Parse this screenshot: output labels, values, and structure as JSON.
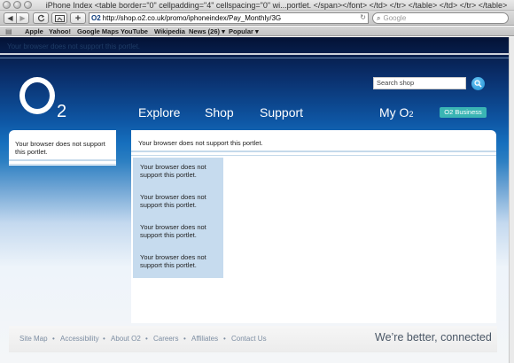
{
  "window": {
    "title": "iPhone Index <table border=\"0\" cellpadding=\"4\" cellspacing=\"0\" wi...portlet. </span></font> </td> </tr> </table> </td> </tr> </table>"
  },
  "toolbar": {
    "back_icon": "◀",
    "forward_icon": "▶",
    "reload_icon": "C",
    "add_icon": "+",
    "url_prefix": "O2",
    "url": "http://shop.o2.co.uk/promo/iphoneindex/Pay_Monthly/3G",
    "search_placeholder": "Google"
  },
  "bookmarks": [
    {
      "label": "Apple"
    },
    {
      "label": "Yahoo!"
    },
    {
      "label": "Google Maps"
    },
    {
      "label": "YouTube"
    },
    {
      "label": "Wikipedia"
    },
    {
      "label": "News (26) ▾"
    },
    {
      "label": "Popular ▾"
    }
  ],
  "page": {
    "top_portlet": "Your browser does not support this portlet.",
    "logo": {
      "o": "O",
      "sub": "2"
    },
    "shop_search_placeholder": "Search shop",
    "nav": [
      "Explore",
      "Shop",
      "Support"
    ],
    "my_o2": {
      "label": "My O",
      "sub": "2"
    },
    "o2_business": "O2 Business",
    "left_portlet": "Your browser does not support this portlet.",
    "main_portlet": "Your browser does not support this portlet.",
    "box_portlets": [
      "Your browser does not support this portlet.",
      "Your browser does not support this portlet.",
      "Your browser does not support this portlet.",
      "Your browser does not support this portlet."
    ],
    "footer_links": [
      "Site Map",
      "Accessibility",
      "About O2",
      "Careers",
      "Affiliates",
      "Contact Us"
    ],
    "tagline": "We’re better, connected"
  },
  "colors": {
    "header_dark": "#041235",
    "header_blue": "#0e56a4",
    "panel_blue": "#c6dbee",
    "business_teal": "#3ab5b4",
    "search_button": "#1d8fd4"
  }
}
